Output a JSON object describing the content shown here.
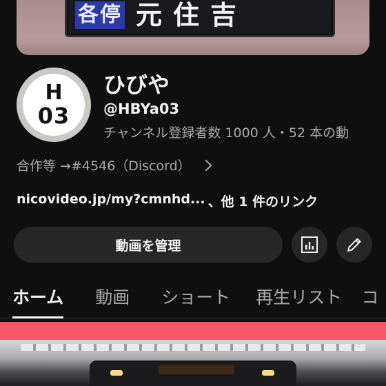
{
  "banner": {
    "type_label": "各停",
    "destination": "元住吉"
  },
  "avatar": {
    "line1": "H",
    "line2": "03"
  },
  "channel": {
    "name": "ひびや",
    "handle": "@HBYa03",
    "stats": "チャンネル登録者数 1000 人・52 本の動"
  },
  "description": {
    "text": "合作等 →#4546（Discord）"
  },
  "links": {
    "primary": "nicovideo.jp/my?cmnhd...",
    "other": "、他 1 件のリンク"
  },
  "actions": {
    "manage_label": "動画を管理",
    "analytics_icon": "analytics-icon",
    "edit_icon": "pencil-icon"
  },
  "tabs": [
    {
      "label": "ホーム",
      "active": true
    },
    {
      "label": "動画",
      "active": false
    },
    {
      "label": "ショート",
      "active": false
    },
    {
      "label": "再生リスト",
      "active": false
    },
    {
      "label": "コ",
      "active": false
    }
  ],
  "colors": {
    "background": "#0f0f0f",
    "button_bg": "#272727",
    "accent_bar": "#f2586a",
    "secondary_text": "#aaaaaa"
  }
}
